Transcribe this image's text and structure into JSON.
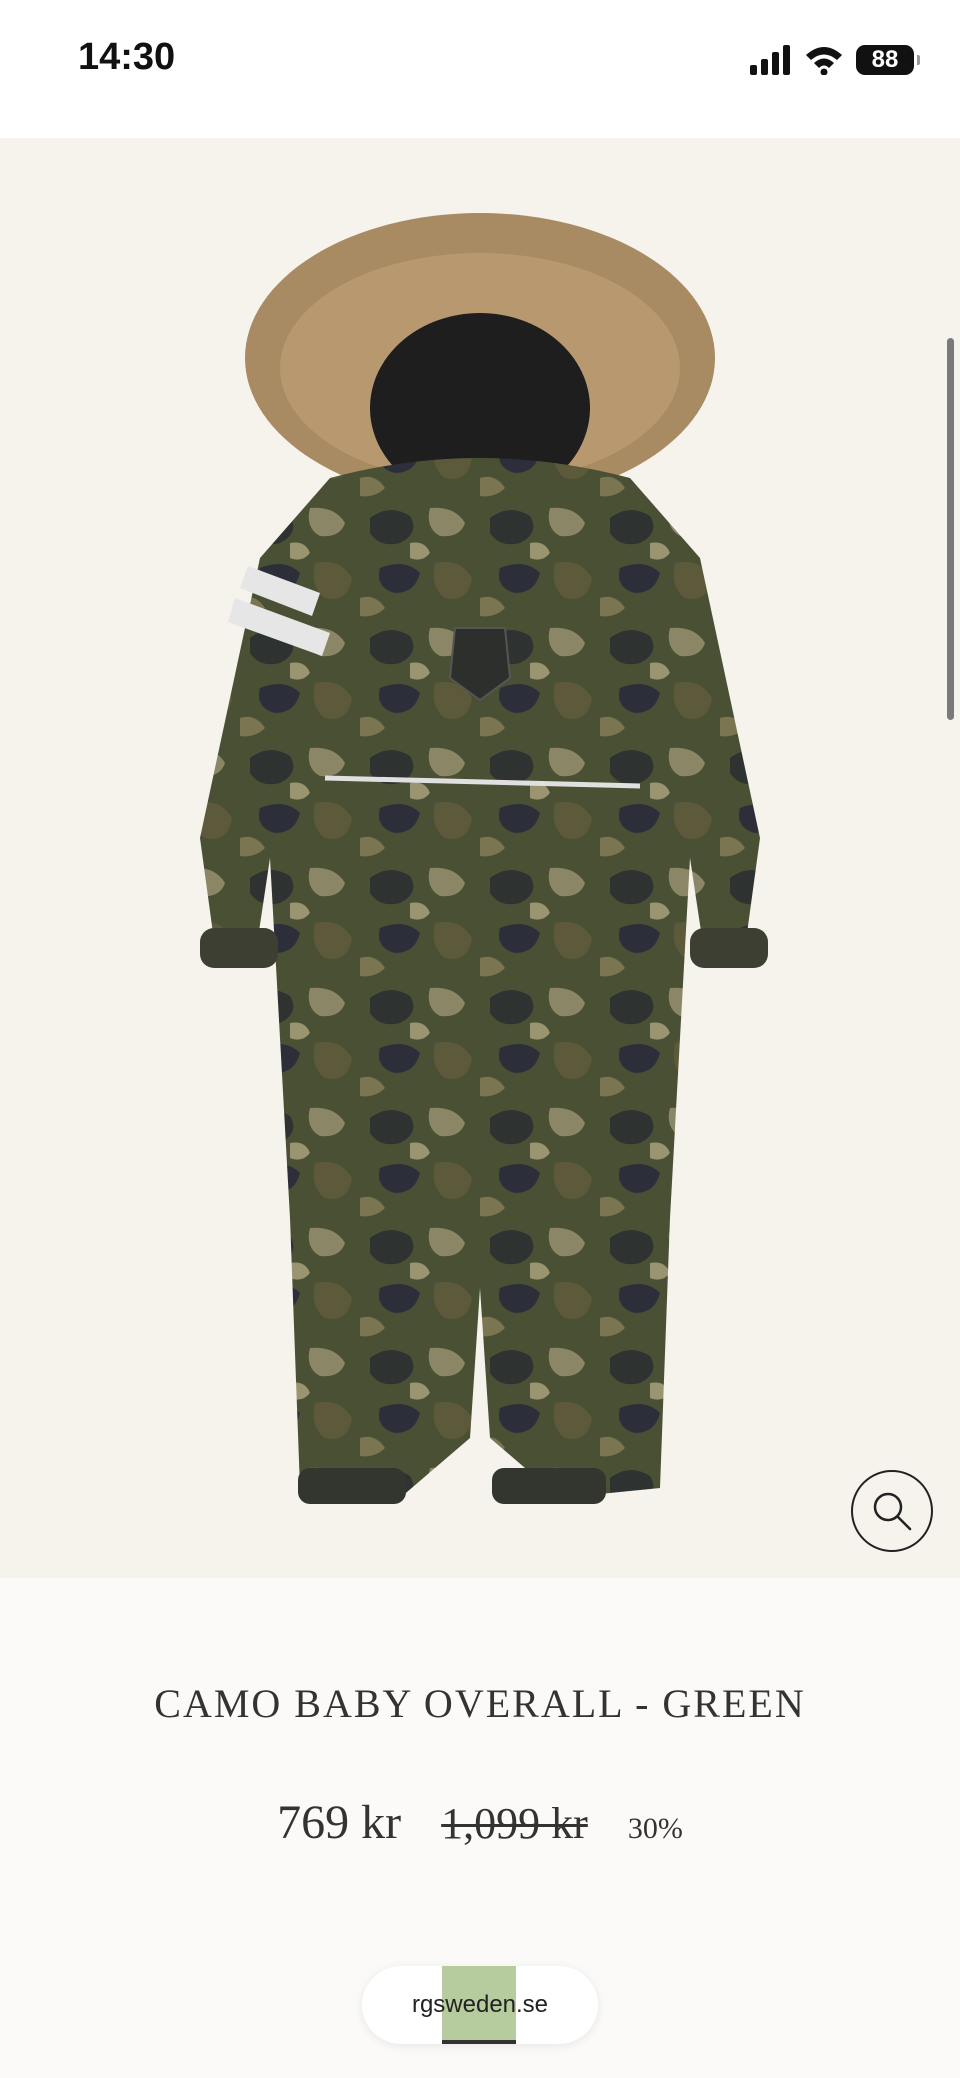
{
  "status_bar": {
    "time": "14:30",
    "battery": "88"
  },
  "product": {
    "title": "CAMO BABY OVERALL - GREEN",
    "price_current": "769 kr",
    "price_original": "1,099 kr",
    "discount": "30%"
  },
  "browser": {
    "url": "rgsweden.se"
  },
  "colors": {
    "image_bg": "#f6f2ec",
    "page_bg": "#fbfaf8",
    "text": "#333333"
  },
  "icons": [
    "signal-icon",
    "wifi-icon",
    "battery-icon",
    "zoom-icon"
  ]
}
